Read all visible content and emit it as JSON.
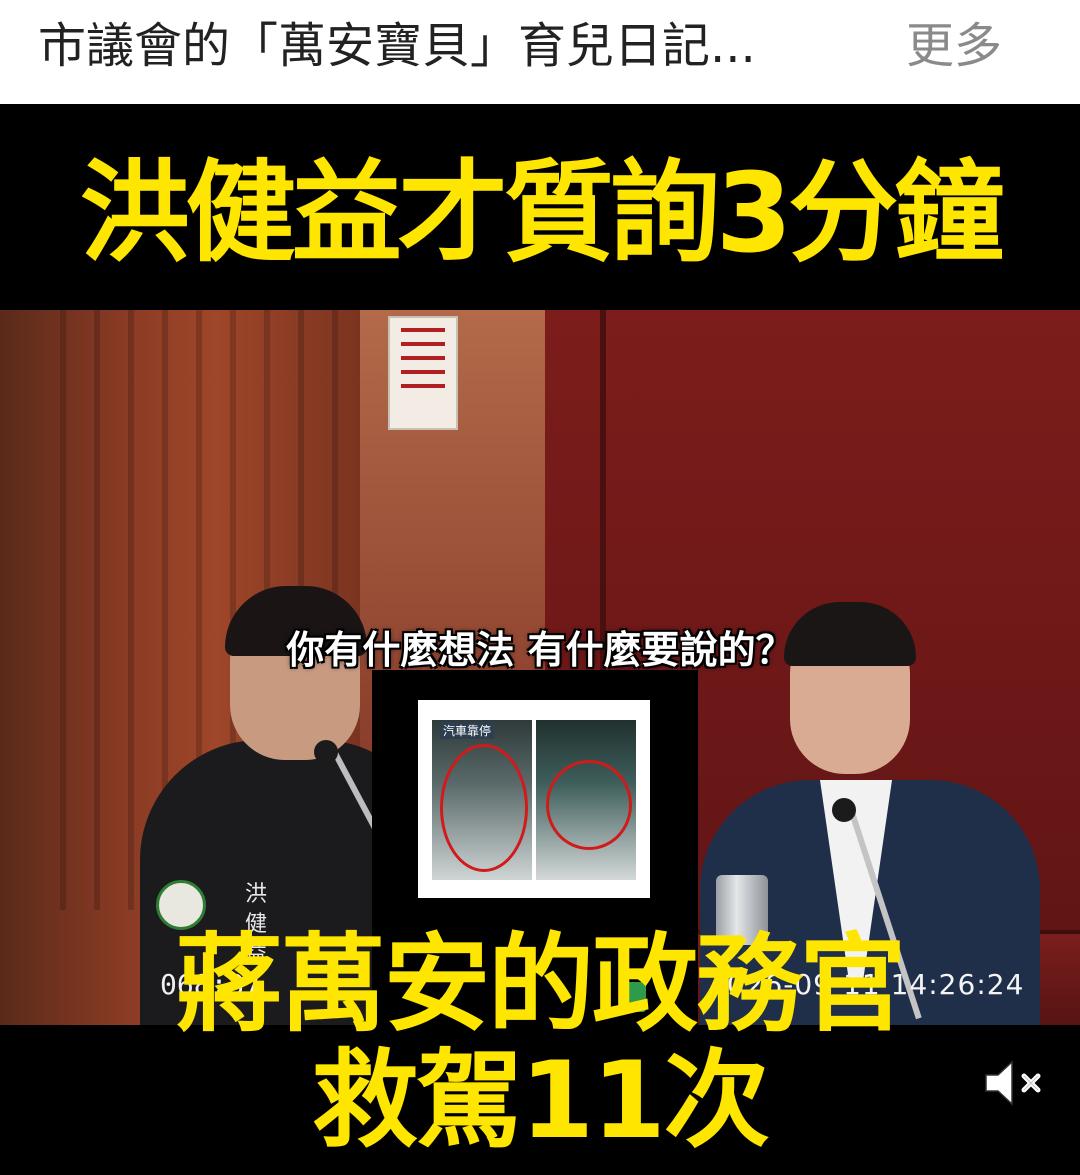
{
  "caption": {
    "text": "市議會的「萬安寶貝」育兒日記...",
    "more_label": "更多"
  },
  "video": {
    "headline_top": "洪健益才質詢3分鐘",
    "subtitle": "你有什麼想法 有什麼要說的？",
    "nameplate": [
      "洪",
      "健",
      "益"
    ],
    "timer": "068:37",
    "timestamp": "2026-09-11 14:26:24",
    "headline_bottom_line1": "蔣萬安的政務官",
    "headline_bottom_line2": "救駕11次",
    "inset_label": "汽車靠停"
  },
  "controls": {
    "mute_icon": "speaker-muted-icon"
  },
  "colors": {
    "headline": "#ffe600",
    "background": "#000000",
    "caption_more": "#8a8a8a"
  }
}
